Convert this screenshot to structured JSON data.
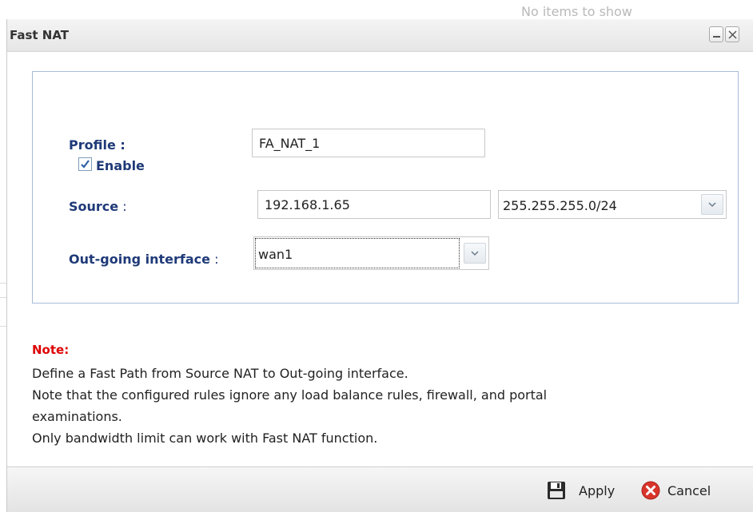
{
  "background": {
    "empty_text": "No items to show"
  },
  "dialog": {
    "title": "Fast NAT",
    "minimize_icon": "minimize-icon",
    "close_icon": "close-icon"
  },
  "form": {
    "profile_label": "Profile :",
    "profile_value": "FA_NAT_1",
    "enable_label": "Enable",
    "enable_checked": true,
    "source_label": "Source",
    "source_colon": " :",
    "source_ip": "192.168.1.65",
    "source_mask": "255.255.255.0/24",
    "outgoing_label": "Out-going interface",
    "outgoing_colon": " :",
    "outgoing_value": "wan1"
  },
  "note": {
    "title": "Note:",
    "lines": [
      "Define a Fast Path from Source NAT to Out-going interface.",
      "Note that the configured rules ignore any load balance rules, firewall, and portal",
      "examinations.",
      "Only bandwidth limit can work with Fast NAT function."
    ]
  },
  "footer": {
    "apply_label": "Apply",
    "apply_icon": "save-icon",
    "cancel_label": "Cancel",
    "cancel_icon": "cancel-icon"
  },
  "colors": {
    "label_blue": "#1f3a78",
    "note_red": "#dd0000",
    "box_border": "#a8bcd9"
  }
}
